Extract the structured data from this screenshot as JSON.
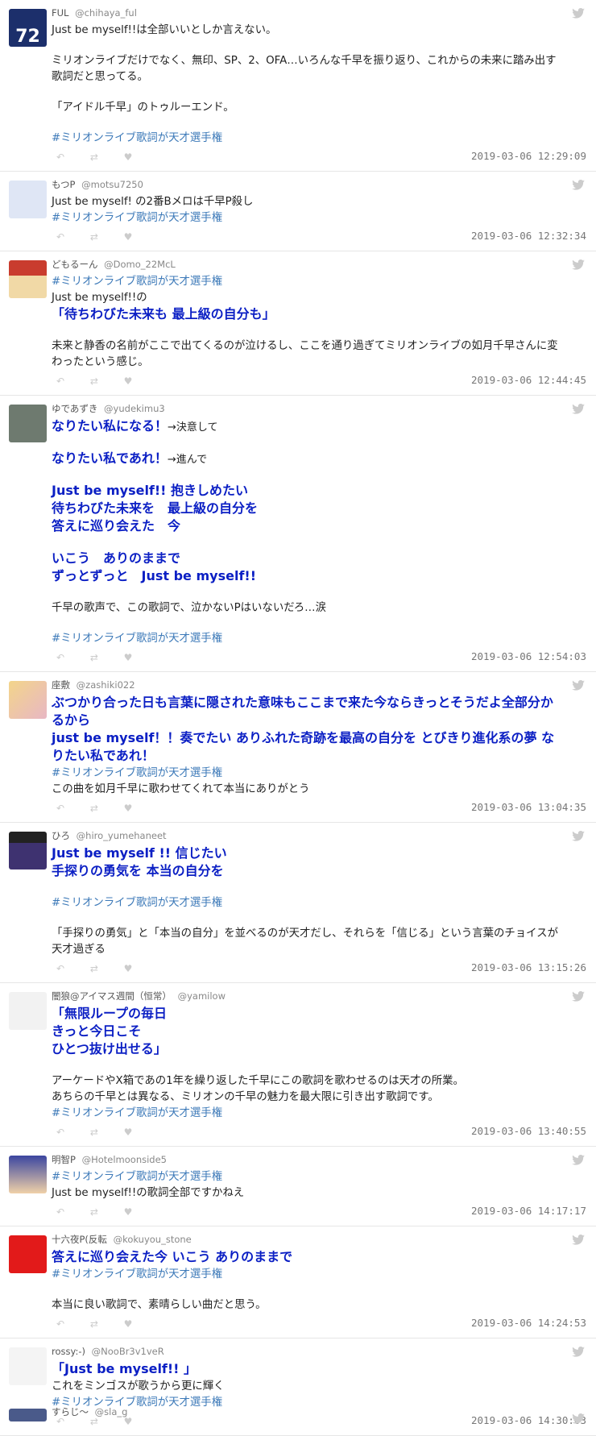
{
  "colors": {
    "accent": "#0b1fc4",
    "hashtag": "#3c79b8",
    "meta": "#888888",
    "divider": "#e6e6e6"
  },
  "icons": {
    "reply": "↶",
    "retweet": "⇄",
    "like": "♥",
    "bird": "twitter-bird-icon"
  },
  "hashtag": "#ミリオンライブ歌詞が天才選手権",
  "tweets": [
    {
      "name": "FUL",
      "handle": "@chihaya_ful",
      "time": "2019-03-06 12:29:09",
      "avatar": "72",
      "lines": [
        {
          "t": "Just be myself!!は全部いいとしか言えない。"
        },
        {
          "gap": true
        },
        {
          "t": "ミリオンライブだけでなく、無印、SP、2、OFA…いろんな千早を振り返り、これからの未来に踏み出す"
        },
        {
          "t": "歌詞だと思ってる。"
        },
        {
          "gap": true
        },
        {
          "t": "「アイドル千早」のトゥルーエンド。"
        },
        {
          "gap": true
        },
        {
          "t": "#ミリオンライブ歌詞が天才選手権",
          "cls": "tag"
        }
      ]
    },
    {
      "name": "もつP",
      "handle": "@motsu7250",
      "time": "2019-03-06 12:32:34",
      "lines": [
        {
          "t": "Just be myself! の2番Bメロは千早P殺し"
        },
        {
          "t": "#ミリオンライブ歌詞が天才選手権",
          "cls": "tag"
        }
      ]
    },
    {
      "name": "どもるーん",
      "handle": "@Domo_22McL",
      "time": "2019-03-06 12:44:45",
      "lines": [
        {
          "t": "#ミリオンライブ歌詞が天才選手権",
          "cls": "tag"
        },
        {
          "t": "Just be myself!!の"
        },
        {
          "t": "「待ちわびた未来も 最上級の自分も」",
          "cls": "hl"
        },
        {
          "gap": true
        },
        {
          "t": "未来と静香の名前がここで出てくるのが泣けるし、ここを通り過ぎてミリオンライブの如月千早さんに変"
        },
        {
          "t": "わったという感じ。"
        }
      ]
    },
    {
      "name": "ゆであずき",
      "handle": "@yudekimu3",
      "time": "2019-03-06 12:54:03",
      "lines": [
        {
          "t": "なりたい私になる！",
          "cls": "hl",
          "after": "→決意して"
        },
        {
          "gap": true
        },
        {
          "t": "なりたい私であれ！",
          "cls": "hl",
          "after": "→進んで"
        },
        {
          "gap": true
        },
        {
          "t": "Just be myself!! 抱きしめたい",
          "cls": "hl"
        },
        {
          "t": "待ちわびた未来を　最上級の自分を",
          "cls": "hl"
        },
        {
          "t": "答えに巡り会えた　今",
          "cls": "hl"
        },
        {
          "gap": true
        },
        {
          "t": "いこう　ありのままで",
          "cls": "hl"
        },
        {
          "t": "ずっとずっと　Just be myself!!",
          "cls": "hl"
        },
        {
          "gap": true
        },
        {
          "t": "千早の歌声で、この歌詞で、泣かないPはいないだろ…涙"
        },
        {
          "gap": true
        },
        {
          "t": "#ミリオンライブ歌詞が天才選手権",
          "cls": "tag"
        }
      ]
    },
    {
      "name": "座敷",
      "handle": "@zashiki022",
      "time": "2019-03-06 13:04:35",
      "lines": [
        {
          "t": "ぶつかり合った日も言葉に隠された意味もここまで来た今ならきっとそうだよ全部分か",
          "cls": "hl"
        },
        {
          "t": "るから",
          "cls": "hl"
        },
        {
          "t": "just be myself！！奏でたい ありふれた奇跡を最高の自分を とびきり進化系の夢 な",
          "cls": "hl"
        },
        {
          "t": "りたい私であれ！",
          "cls": "hl"
        },
        {
          "t": "#ミリオンライブ歌詞が天才選手権",
          "cls": "tag"
        },
        {
          "t": "この曲を如月千早に歌わせてくれて本当にありがとう"
        }
      ]
    },
    {
      "name": "ひろ",
      "handle": "@hiro_yumehaneet",
      "time": "2019-03-06 13:15:26",
      "lines": [
        {
          "t": "Just be myself !!  信じたい",
          "cls": "hl"
        },
        {
          "t": "手探りの勇気を  本当の自分を",
          "cls": "hl"
        },
        {
          "gap": true
        },
        {
          "t": "#ミリオンライブ歌詞が天才選手権",
          "cls": "tag"
        },
        {
          "gap": true
        },
        {
          "t": "「手探りの勇気」と「本当の自分」を並べるのが天才だし、それらを「信じる」という言葉のチョイスが"
        },
        {
          "t": "天才過ぎる"
        }
      ]
    },
    {
      "name": "闇狼@アイマス週間（恒常）",
      "handle": "@yamilow",
      "time": "2019-03-06 13:40:55",
      "lines": [
        {
          "t": "「無限ループの毎日",
          "cls": "hl"
        },
        {
          "t": "きっと今日こそ",
          "cls": "hl"
        },
        {
          "t": "ひとつ抜け出せる」",
          "cls": "hl"
        },
        {
          "gap": true
        },
        {
          "t": "アーケードやX箱であの1年を繰り返した千早にこの歌詞を歌わせるのは天才の所業。"
        },
        {
          "t": "あちらの千早とは異なる、ミリオンの千早の魅力を最大限に引き出す歌詞です。"
        },
        {
          "t": " #ミリオンライブ歌詞が天才選手権",
          "cls": "tag"
        }
      ]
    },
    {
      "name": "明智P",
      "handle": "@Hotelmoonside5",
      "time": "2019-03-06 14:17:17",
      "lines": [
        {
          "t": "#ミリオンライブ歌詞が天才選手権",
          "cls": "tag"
        },
        {
          "t": "Just be myself!!の歌詞全部ですかねえ"
        }
      ]
    },
    {
      "name": "十六夜P(反転",
      "handle": "@kokuyou_stone",
      "time": "2019-03-06 14:24:53",
      "lines": [
        {
          "t": "答えに巡り会えた今 いこう ありのままで",
          "cls": "hl"
        },
        {
          "t": " #ミリオンライブ歌詞が天才選手権",
          "cls": "tag"
        },
        {
          "gap": true
        },
        {
          "t": "本当に良い歌詞で、素晴らしい曲だと思う。"
        }
      ]
    },
    {
      "name": "rossy:-)",
      "handle": "@NooBr3v1veR",
      "time": "2019-03-06 14:30:03",
      "lines": [
        {
          "t": "「Just be myself!! 」",
          "cls": "hl"
        },
        {
          "t": "これをミンゴスが歌うから更に輝く"
        },
        {
          "t": "#ミリオンライブ歌詞が天才選手権",
          "cls": "tag"
        }
      ]
    }
  ],
  "partial": {
    "name": "すらじ〜",
    "handle": "@sla_g"
  }
}
